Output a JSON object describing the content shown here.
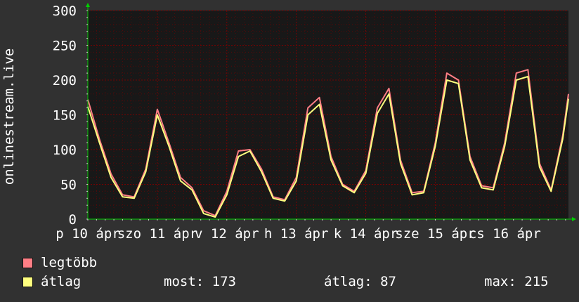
{
  "chart_data": {
    "type": "line",
    "ylabel": "onlinestream.live",
    "ylim": [
      0,
      300
    ],
    "yticks": [
      0,
      50,
      100,
      150,
      200,
      250,
      300
    ],
    "grid": true,
    "legend_position": "bottom-left",
    "x_tick_labels": [
      "p 10 ápr",
      "szo 11 ápr",
      "v 12 ápr",
      "h 13 ápr",
      "k 14 ápr",
      "sze 15 ápr",
      "cs 16 ápr"
    ],
    "x_tick_positions_hours": [
      0,
      24,
      48,
      72,
      96,
      120,
      144
    ],
    "x_range_hours": [
      0,
      166
    ],
    "hours": [
      0,
      4,
      8,
      12,
      16,
      20,
      24,
      28,
      32,
      36,
      40,
      44,
      48,
      52,
      56,
      60,
      64,
      68,
      72,
      76,
      80,
      84,
      88,
      92,
      96,
      100,
      104,
      108,
      112,
      116,
      120,
      124,
      128,
      132,
      136,
      140,
      144,
      148,
      152,
      156,
      160,
      164,
      166
    ],
    "series": [
      {
        "name": "legtöbb",
        "color": "#ff7f86",
        "values": [
          172,
          115,
          65,
          35,
          32,
          72,
          158,
          110,
          60,
          45,
          12,
          5,
          40,
          98,
          100,
          72,
          32,
          28,
          60,
          160,
          175,
          90,
          50,
          40,
          70,
          160,
          188,
          85,
          38,
          40,
          110,
          210,
          200,
          90,
          48,
          45,
          110,
          210,
          215,
          80,
          42,
          120,
          180
        ]
      },
      {
        "name": "átlag",
        "color": "#ffff7f",
        "values": [
          162,
          110,
          60,
          32,
          30,
          68,
          150,
          105,
          55,
          42,
          8,
          3,
          35,
          90,
          98,
          68,
          30,
          26,
          55,
          150,
          165,
          85,
          48,
          38,
          66,
          152,
          180,
          80,
          35,
          38,
          105,
          200,
          195,
          85,
          45,
          42,
          105,
          200,
          205,
          75,
          40,
          115,
          173
        ]
      }
    ],
    "stats": {
      "current_label": "most:",
      "current_value": "173",
      "average_label": "átlag:",
      "average_value": "87",
      "max_label": "max:",
      "max_value": "215"
    },
    "axis_color": "#00d000",
    "grid_color": "#800000",
    "plot_background": "#181818"
  }
}
